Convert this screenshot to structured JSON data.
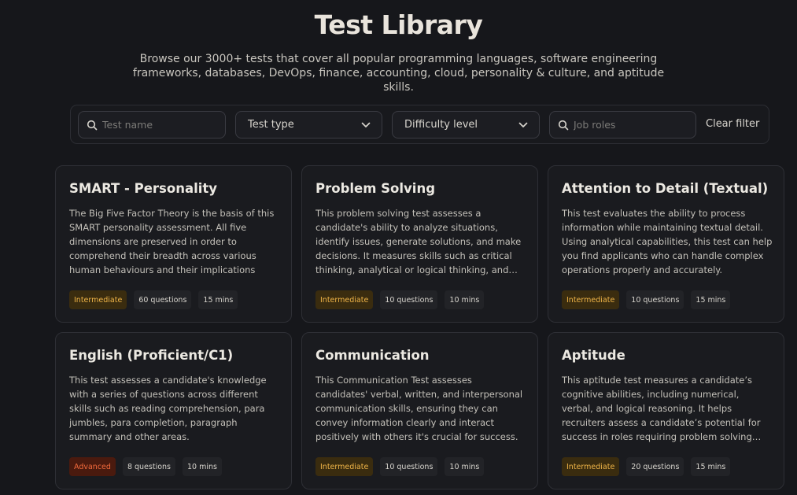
{
  "header": {
    "title": "Test Library",
    "subtitle": "Browse our 3000+ tests that cover all popular programming languages, software engineering frameworks, databases, DevOps, finance, accounting, cloud, personality & culture, and aptitude skills."
  },
  "filters": {
    "test_name_placeholder": "Test name",
    "test_type_label": "Test type",
    "difficulty_label": "Difficulty level",
    "job_roles_placeholder": "Job roles",
    "clear_label": "Clear filter"
  },
  "cards": [
    {
      "title": "SMART - Personality",
      "description": "The Big Five Factor Theory is the basis of this SMART personality assessment. All five dimensions are preserved in order to comprehend their breadth across various human behaviours and their implications",
      "level": "Intermediate",
      "questions": "60 questions",
      "duration": "15 mins"
    },
    {
      "title": "Problem Solving",
      "description": "This problem solving test assesses a candidate's ability to analyze situations, identify issues, generate solutions, and make decisions. It measures skills such as critical thinking, analytical or logical thinking, and more.",
      "level": "Intermediate",
      "questions": "10 questions",
      "duration": "10 mins"
    },
    {
      "title": "Attention to Detail (Textual)",
      "description": "This test evaluates the ability to process information while maintaining textual detail. Using analytical capabilities, this test can help you find applicants who can handle complex operations properly and accurately.",
      "level": "Intermediate",
      "questions": "10 questions",
      "duration": "15 mins"
    },
    {
      "title": "English (Proficient/C1)",
      "description": "This test assesses a candidate's knowledge with a series of questions across different skills such as reading comprehension, para jumbles, para completion, paragraph summary and other areas.",
      "level": "Advanced",
      "questions": "8 questions",
      "duration": "10 mins"
    },
    {
      "title": "Communication",
      "description": "This Communication Test assesses candidates' verbal, written, and interpersonal communication skills, ensuring they can convey information clearly and interact positively with others it's crucial for success.",
      "level": "Intermediate",
      "questions": "10 questions",
      "duration": "10 mins"
    },
    {
      "title": "Aptitude",
      "description": "This aptitude test measures a candidate’s cognitive abilities, including numerical, verbal, and logical reasoning. It helps recruiters assess a candidate’s potential for success in roles requiring problem solving skills.",
      "level": "Intermediate",
      "questions": "20 questions",
      "duration": "15 mins"
    }
  ]
}
